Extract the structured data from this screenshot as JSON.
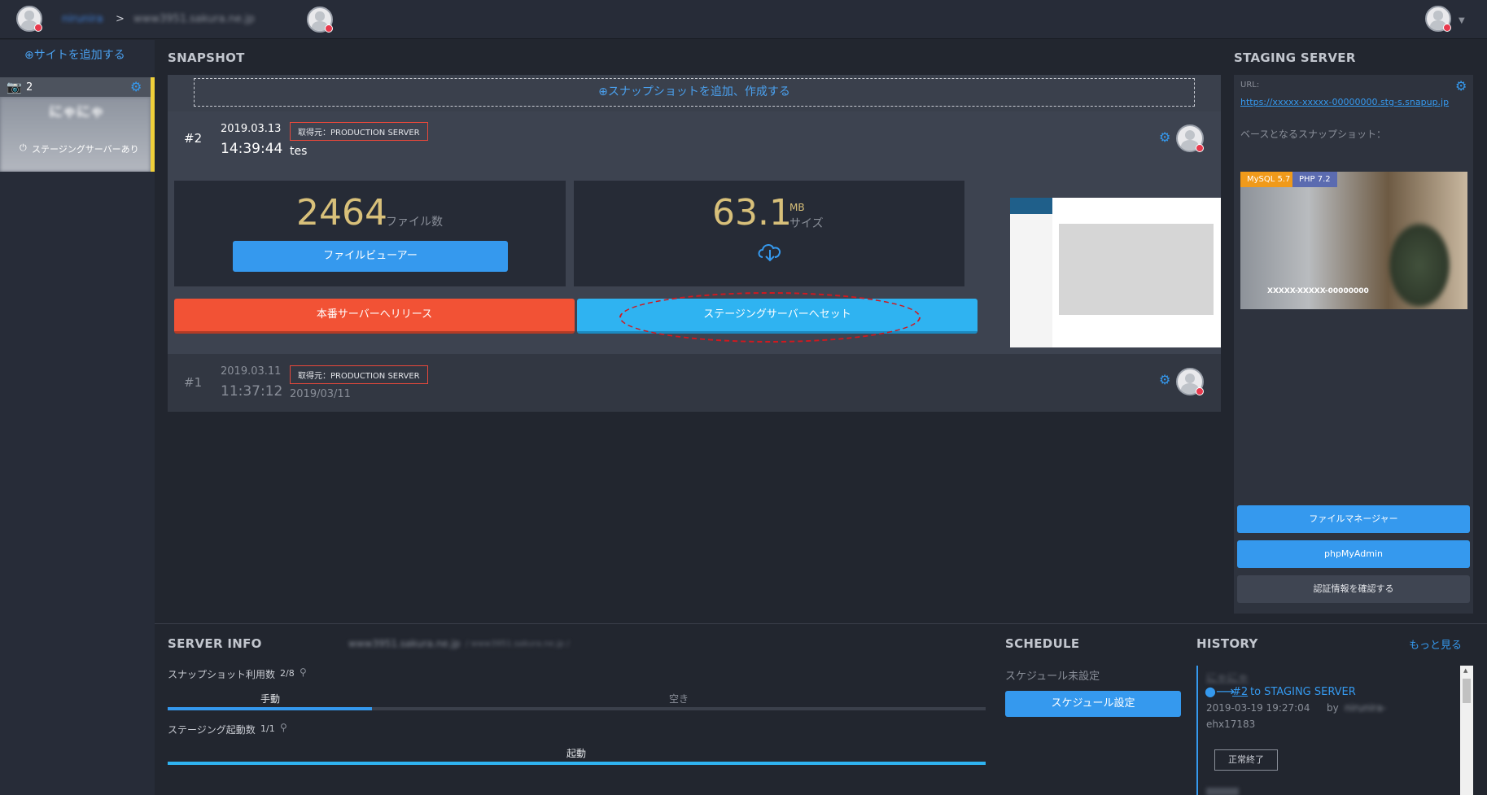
{
  "topbar": {
    "user_name": "nirunira",
    "breadcrumb_sep": ">",
    "site_name": "www3951.sakura.ne.jp"
  },
  "sidebar": {
    "add_site_label": "サイトを追加する",
    "site_card": {
      "snapshot_count": "2",
      "site_title": "にゃにゃ",
      "staging_label": "ステージングサーバーあり"
    }
  },
  "snapshot": {
    "title": "SNAPSHOT",
    "add_label": "スナップショットを追加、作成する",
    "items": [
      {
        "number": "#2",
        "date": "2019.03.13",
        "time": "14:39:44",
        "source_tag": "取得元：PRODUCTION SERVER",
        "comment": "tes",
        "file_count": "2464",
        "file_count_label": "ファイル数",
        "file_viewer_label": "ファイルビューアー",
        "size_value": "63.1",
        "size_unit": "MB",
        "size_label": "サイズ",
        "release_label": "本番サーバーへリリース",
        "staging_set_label": "ステージングサーバーへセット"
      },
      {
        "number": "#1",
        "date": "2019.03.11",
        "time": "11:37:12",
        "source_tag": "取得元：PRODUCTION SERVER",
        "comment": "2019/03/11"
      }
    ]
  },
  "staging": {
    "title": "STAGING SERVER",
    "url_label": "URL:",
    "url": "https://xxxxx-xxxxx-00000000.stg-s.snapup.jp",
    "base_snapshot_label": "ベースとなるスナップショット：",
    "badge_mysql": "MySQL 5.7",
    "badge_php": "PHP 7.2",
    "preview_caption": "XXXXX-XXXXX-00000000",
    "file_manager_label": "ファイルマネージャー",
    "phpmyadmin_label": "phpMyAdmin",
    "auth_label": "認証情報を確認する"
  },
  "server_info": {
    "title": "SERVER INFO",
    "host": "www3951.sakura.ne.jp",
    "host_sub": "/ www3951.sakura.ne.jp /",
    "snapshot_usage_label": "スナップショット利用数",
    "snapshot_usage_value": "2/8",
    "manual_label": "手動",
    "free_label": "空き",
    "manual_fraction": 0.25,
    "staging_usage_label": "ステージング起動数",
    "staging_usage_value": "1/1",
    "running_label": "起動",
    "running_fraction": 1.0
  },
  "schedule": {
    "title": "SCHEDULE",
    "status": "スケジュール未設定",
    "button_label": "スケジュール設定"
  },
  "history": {
    "title": "HISTORY",
    "more_label": "もっと見る",
    "entry": {
      "site": "にゃにゃ",
      "ref": "#2",
      "target": "to STAGING SERVER",
      "timestamp": "2019-03-19 19:27:04",
      "by_label": "by",
      "user": "nirunira-",
      "user_id": "ehx17183",
      "status": "正常終了"
    }
  },
  "colors": {
    "accent_blue": "#3599ee",
    "sky": "#2fb3f1",
    "danger": "#f25235",
    "number_gold": "#d8c07a",
    "bg": "#22262f"
  }
}
